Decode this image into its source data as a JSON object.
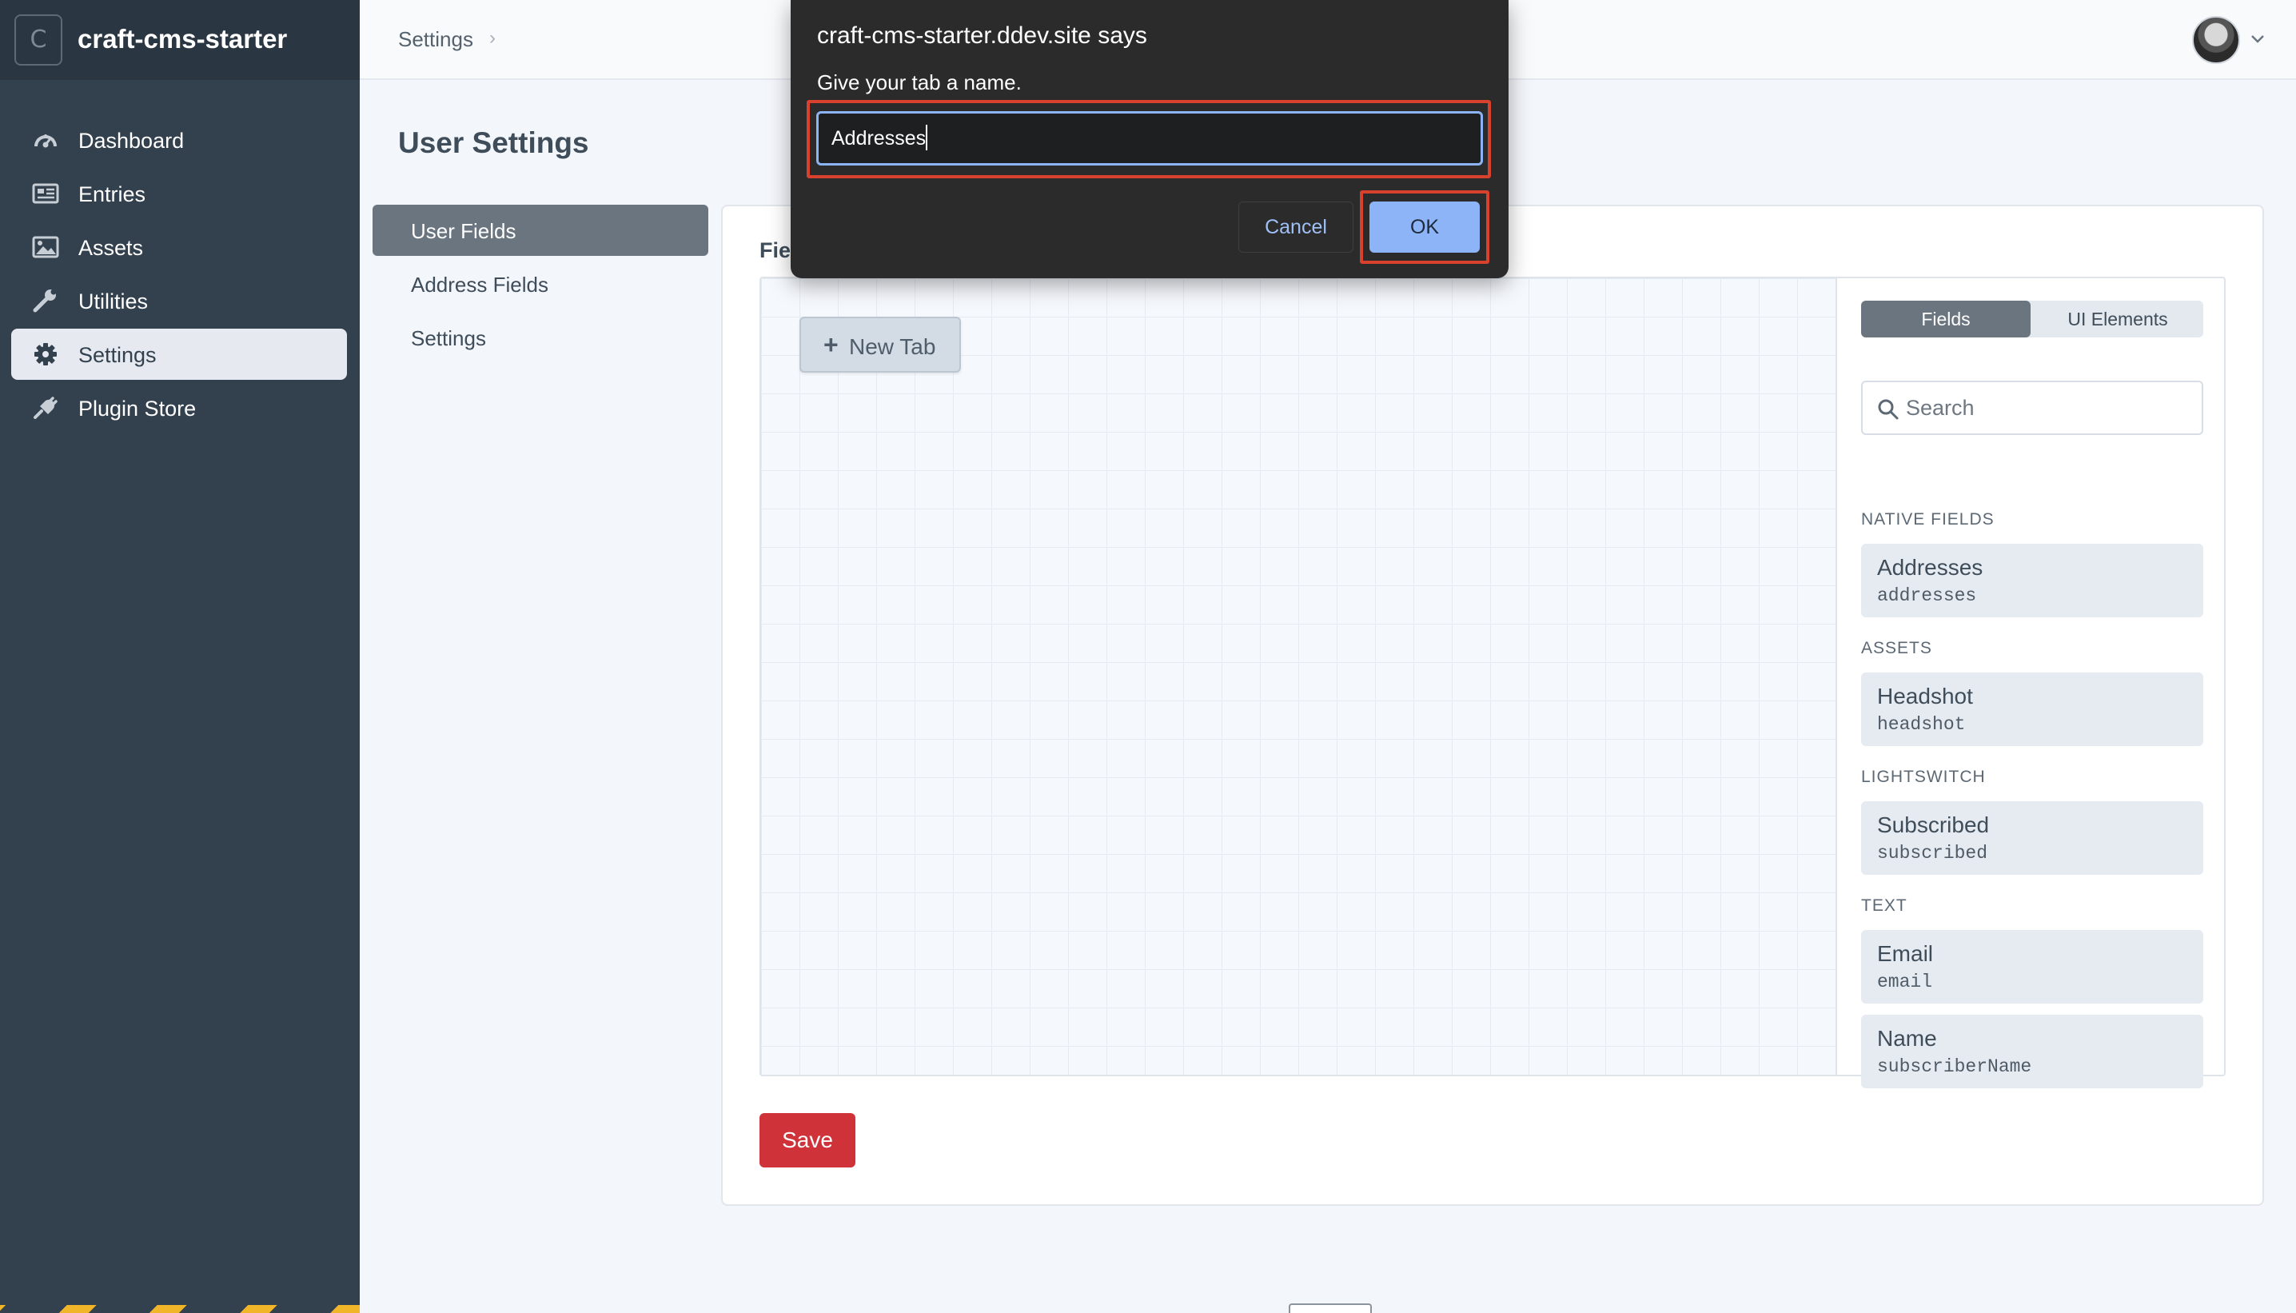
{
  "app": {
    "logo_letter": "C",
    "name": "craft-cms-starter"
  },
  "sidebar": {
    "items": [
      {
        "label": "Dashboard",
        "icon": "dashboard-icon"
      },
      {
        "label": "Entries",
        "icon": "entries-icon"
      },
      {
        "label": "Assets",
        "icon": "assets-icon"
      },
      {
        "label": "Utilities",
        "icon": "wrench-icon"
      },
      {
        "label": "Settings",
        "icon": "gear-icon",
        "active": true
      },
      {
        "label": "Plugin Store",
        "icon": "plug-icon"
      }
    ]
  },
  "header": {
    "breadcrumb": "Settings"
  },
  "page": {
    "title": "User Settings"
  },
  "subnav": {
    "items": [
      {
        "label": "User Fields",
        "active": true
      },
      {
        "label": "Address Fields"
      },
      {
        "label": "Settings"
      }
    ]
  },
  "layout": {
    "section_title": "Fie",
    "new_tab_label": "New Tab",
    "tabs": {
      "fields": "Fields",
      "ui_elements": "UI Elements"
    },
    "search_placeholder": "Search",
    "groups": [
      {
        "heading": "NATIVE FIELDS",
        "fields": [
          {
            "name": "Addresses",
            "handle": "addresses"
          }
        ]
      },
      {
        "heading": "ASSETS",
        "fields": [
          {
            "name": "Headshot",
            "handle": "headshot"
          }
        ]
      },
      {
        "heading": "LIGHTSWITCH",
        "fields": [
          {
            "name": "Subscribed",
            "handle": "subscribed"
          }
        ]
      },
      {
        "heading": "TEXT",
        "fields": [
          {
            "name": "Email",
            "handle": "email"
          },
          {
            "name": "Name",
            "handle": "subscriberName"
          }
        ]
      }
    ],
    "save_label": "Save"
  },
  "dialog": {
    "title": "craft-cms-starter.ddev.site says",
    "message": "Give your tab a name.",
    "input_value": "Addresses",
    "cancel_label": "Cancel",
    "ok_label": "OK"
  },
  "colors": {
    "sidebar_bg": "#33404d",
    "accent_red": "#cf3339",
    "dialog_bg": "#2b2b2c",
    "dialog_ok": "#8db4f6",
    "highlight_box": "#d8412d"
  }
}
